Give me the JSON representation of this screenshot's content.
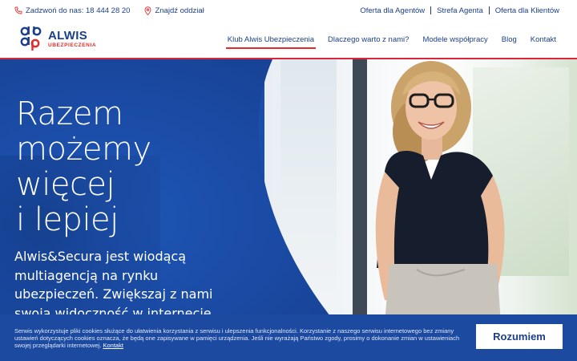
{
  "topbar": {
    "phone_label": "Zadzwoń do nas: 18 444 28 20",
    "branch_label": "Znajdź oddział",
    "links": [
      "Oferta dla Agentów",
      "Strefa Agenta",
      "Oferta dla Klientów"
    ]
  },
  "logo": {
    "brand": "ALWIS",
    "sub": "UBEZPIECZENIA"
  },
  "nav": {
    "items": [
      "Klub Alwis Ubezpieczenia",
      "Dlaczego warto z nami?",
      "Modele współpracy",
      "Blog",
      "Kontakt"
    ],
    "active_index": 0
  },
  "hero": {
    "title_lines": [
      "Razem",
      "możemy",
      "więcej",
      "i lepiej"
    ],
    "text": "Alwis&Secura jest wiodącą multiagencją na rynku ubezpieczeń. Zwiększaj z nami swoją widoczność w internecie."
  },
  "cookie": {
    "text": "Serwis wykorzystuje pliki cookies służące do ułatwienia korzystania z serwisu i ulepszenia funkcjonalności. Korzystanie z naszego serwisu internetowego bez zmiany ustawień dotyczących cookies oznacza, że będą one zapisywane w pamięci urządzenia. Jeśli nie wyrażają Państwo zgody, prosimy o dokonanie zmian w ustawieniach swojej przeglądarki internetowej.",
    "link": "Kontakt",
    "button": "Rozumiem"
  },
  "colors": {
    "brand_blue": "#1c3f8c",
    "accent_red": "#e22b2b",
    "hero_blue": "#1a4ea8"
  }
}
